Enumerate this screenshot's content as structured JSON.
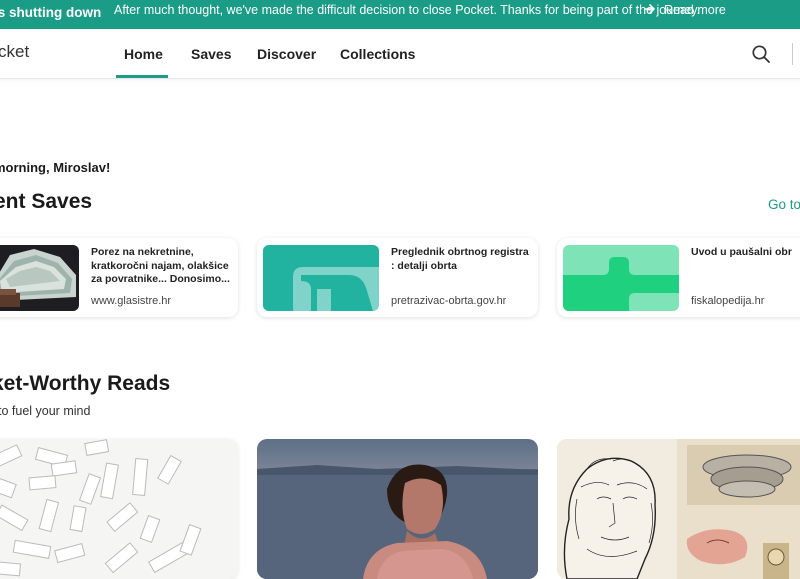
{
  "banner": {
    "title": "is shutting down",
    "message": "After much thought, we've made the difficult decision to close Pocket. Thanks for being part of the journey.",
    "link_label": "Read more",
    "color": "#1a9c87"
  },
  "nav": {
    "logo": "cket",
    "items": [
      {
        "label": "Home",
        "active": true
      },
      {
        "label": "Saves"
      },
      {
        "label": "Discover"
      },
      {
        "label": "Collections"
      }
    ],
    "search_icon": "search-icon"
  },
  "greeting": "morning, Miroslav!",
  "recent_saves": {
    "heading": "ent Saves",
    "go_to_link": "Go to",
    "items": [
      {
        "title": "Porez na nekretnine, kratkoročni najam, olakšice za povratnike... Donosimo...",
        "source": "www.glasistre.hr"
      },
      {
        "title": "Preglednik obrtnog registra : detalji obrta",
        "source": "pretrazivac-obrta.gov.hr"
      },
      {
        "title": "Uvod u paušalni obr",
        "source": "fiskalopedija.hr"
      }
    ]
  },
  "pocket_worthy": {
    "heading": "ket-Worthy Reads",
    "subheading": "to fuel your mind"
  }
}
